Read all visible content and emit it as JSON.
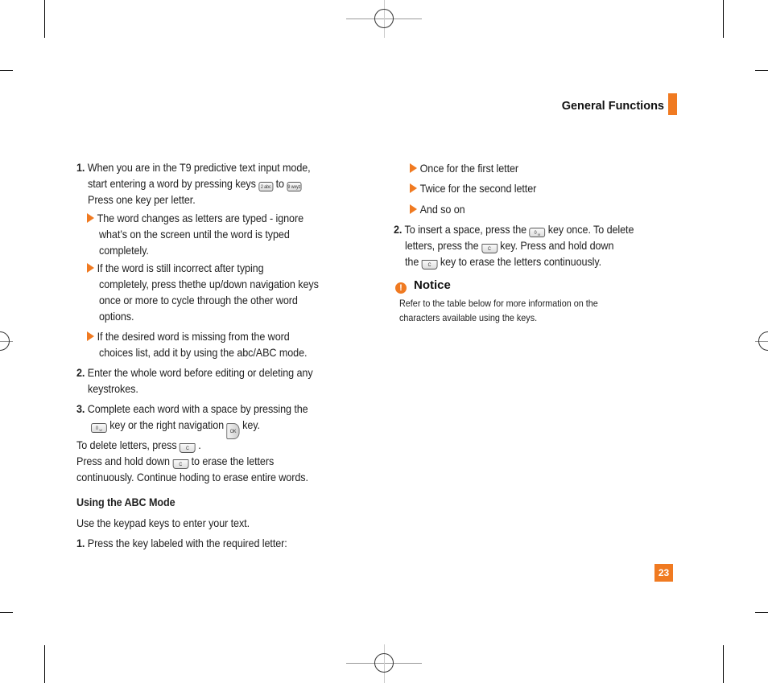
{
  "header": {
    "section_title": "General Functions",
    "accent_color": "#f07a21"
  },
  "left_column": {
    "step1": {
      "number": "1.",
      "line1": "When you are in the T9 predictive text input mode,",
      "line2_pre": "start entering a word by pressing keys",
      "line2_mid": "to",
      "line3": "Press one key per letter.",
      "key_from": "2",
      "key_to": "9"
    },
    "bullets": [
      {
        "lines": [
          "The word changes as letters are typed - ignore",
          "what’s on the screen until the word is typed",
          "completely."
        ]
      },
      {
        "lines": [
          "If the word is still incorrect after typing",
          "completely, press thethe up/down navigation keys",
          "once or more to cycle through the other word",
          "options."
        ]
      },
      {
        "lines": [
          "If the desired word is missing from the word",
          "choices list, add it by using the abc/ABC mode."
        ]
      }
    ],
    "step2": {
      "number": "2.",
      "lines": [
        "Enter the whole word before editing or deleting any",
        "keystrokes."
      ]
    },
    "step3": {
      "number": "3.",
      "line1": "Complete each word with a space by pressing the",
      "line2_a": "key or the right navigation",
      "line2_b": "key."
    },
    "delete_line1_a": "To delete letters, press",
    "delete_line1_b": ".",
    "delete_line2_a": "Press and hold down",
    "delete_line2_b": "to erase the letters",
    "delete_line3": "continuously. Continue hoding to erase entire words.",
    "abc_heading": "Using the ABC Mode",
    "abc_intro": "Use the keypad keys to enter your text.",
    "abc_step1": {
      "number": "1.",
      "text": "Press the key labeled with the required letter:"
    }
  },
  "right_column": {
    "bullets": [
      "Once for the first letter",
      "Twice for the second letter",
      "And so on"
    ],
    "step2": {
      "number": "2.",
      "line1_a": "To insert a space, press the",
      "line1_b": "key once. To delete",
      "line2_a": "letters, press the",
      "line2_b": "key. Press and hold down",
      "line3_a": "the",
      "line3_b": "key to erase the letters continuously."
    },
    "notice": {
      "icon": "!",
      "title": "Notice",
      "lines": [
        "Refer to the table below for more information on the",
        "characters available using the keys."
      ]
    }
  },
  "keys": {
    "zero": "0 ␣",
    "clear": "C",
    "nav": "OK",
    "two": "2 abc",
    "nine": "9 wxyz"
  },
  "footer": {
    "page_number": "23"
  }
}
